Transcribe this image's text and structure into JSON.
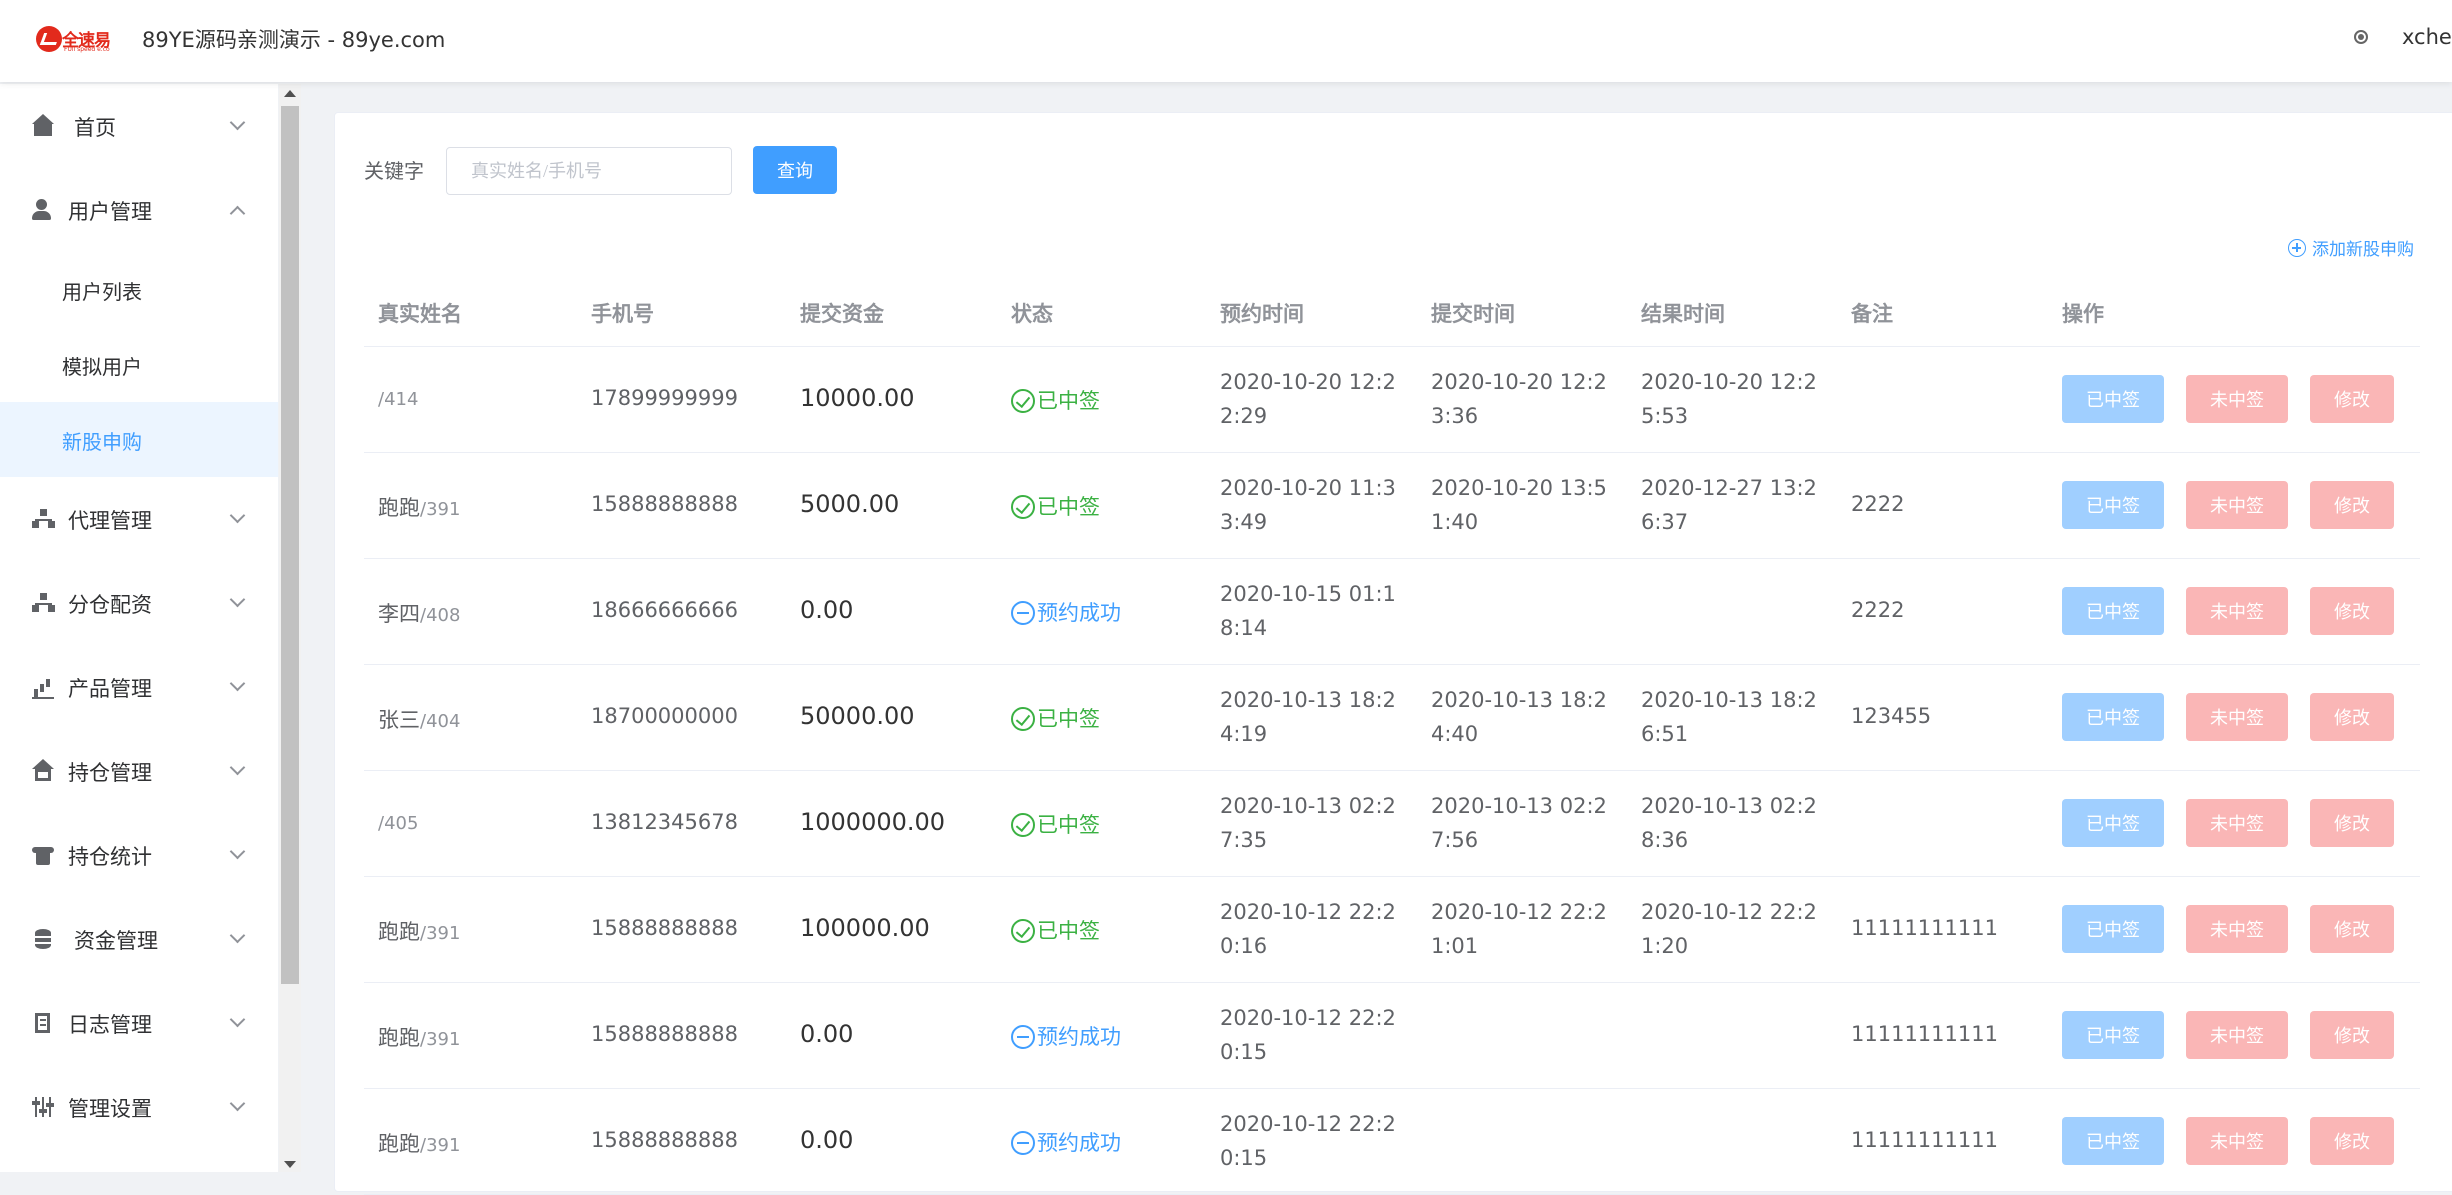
{
  "header": {
    "logo_text": "全速易",
    "logo_sub": "FUll speed e.co",
    "title": "89YE源码亲测演示 - 89ye.com",
    "user": "xchen"
  },
  "sidebar": {
    "items": [
      {
        "label": "首页",
        "icon": "home-icon",
        "expanded": false
      },
      {
        "label": "用户管理",
        "icon": "user-gear-icon",
        "expanded": true
      },
      {
        "label": "用户列表",
        "sub": true
      },
      {
        "label": "模拟用户",
        "sub": true
      },
      {
        "label": "新股申购",
        "sub": true,
        "active": true
      },
      {
        "label": "代理管理",
        "icon": "org-chart-icon",
        "expanded": false
      },
      {
        "label": "分仓配资",
        "icon": "org-chart-icon",
        "expanded": false
      },
      {
        "label": "产品管理",
        "icon": "chart-icon",
        "expanded": false
      },
      {
        "label": "持仓管理",
        "icon": "house-icon",
        "expanded": false
      },
      {
        "label": "持仓统计",
        "icon": "shirt-icon",
        "expanded": false
      },
      {
        "label": "资金管理",
        "icon": "database-icon",
        "expanded": false
      },
      {
        "label": "日志管理",
        "icon": "log-icon",
        "expanded": false
      },
      {
        "label": "管理设置",
        "icon": "settings-icon",
        "expanded": false
      }
    ]
  },
  "search": {
    "label": "关键字",
    "placeholder": "真实姓名/手机号",
    "value": "",
    "button": "查询"
  },
  "add_link": "添加新股申购",
  "colors": {
    "primary": "#409eff",
    "success": "#3bb143",
    "danger_light": "#fab6b6",
    "primary_light": "#a0cfff"
  },
  "table": {
    "columns": [
      "真实姓名",
      "手机号",
      "提交资金",
      "状态",
      "预约时间",
      "提交时间",
      "结果时间",
      "备注",
      "操作"
    ],
    "actions": {
      "win": "已中签",
      "lose": "未中签",
      "edit": "修改"
    },
    "rows": [
      {
        "name": "",
        "id": "/414",
        "phone": "17899999999",
        "amount": "10000.00",
        "status": "已中签",
        "status_type": "won",
        "reserve_time": "2020-10-20 12:22:29",
        "submit_time": "2020-10-20 12:23:36",
        "result_time": "2020-10-20 12:25:53",
        "note": ""
      },
      {
        "name": "跑跑",
        "id": "/391",
        "phone": "15888888888",
        "amount": "5000.00",
        "status": "已中签",
        "status_type": "won",
        "reserve_time": "2020-10-20 11:33:49",
        "submit_time": "2020-10-20 13:51:40",
        "result_time": "2020-12-27 13:26:37",
        "note": "2222"
      },
      {
        "name": "李四",
        "id": "/408",
        "phone": "18666666666",
        "amount": "0.00",
        "status": "预约成功",
        "status_type": "pending",
        "reserve_time": "2020-10-15 01:18:14",
        "submit_time": "",
        "result_time": "",
        "note": "2222"
      },
      {
        "name": "张三",
        "id": "/404",
        "phone": "18700000000",
        "amount": "50000.00",
        "status": "已中签",
        "status_type": "won",
        "reserve_time": "2020-10-13 18:24:19",
        "submit_time": "2020-10-13 18:24:40",
        "result_time": "2020-10-13 18:26:51",
        "note": "123455"
      },
      {
        "name": "",
        "id": "/405",
        "phone": "13812345678",
        "amount": "1000000.00",
        "status": "已中签",
        "status_type": "won",
        "reserve_time": "2020-10-13 02:27:35",
        "submit_time": "2020-10-13 02:27:56",
        "result_time": "2020-10-13 02:28:36",
        "note": ""
      },
      {
        "name": "跑跑",
        "id": "/391",
        "phone": "15888888888",
        "amount": "100000.00",
        "status": "已中签",
        "status_type": "won",
        "reserve_time": "2020-10-12 22:20:16",
        "submit_time": "2020-10-12 22:21:01",
        "result_time": "2020-10-12 22:21:20",
        "note": "11111111111"
      },
      {
        "name": "跑跑",
        "id": "/391",
        "phone": "15888888888",
        "amount": "0.00",
        "status": "预约成功",
        "status_type": "pending",
        "reserve_time": "2020-10-12 22:20:15",
        "submit_time": "",
        "result_time": "",
        "note": "11111111111"
      },
      {
        "name": "跑跑",
        "id": "/391",
        "phone": "15888888888",
        "amount": "0.00",
        "status": "预约成功",
        "status_type": "pending",
        "reserve_time": "2020-10-12 22:20:15",
        "submit_time": "",
        "result_time": "",
        "note": "11111111111"
      }
    ]
  }
}
